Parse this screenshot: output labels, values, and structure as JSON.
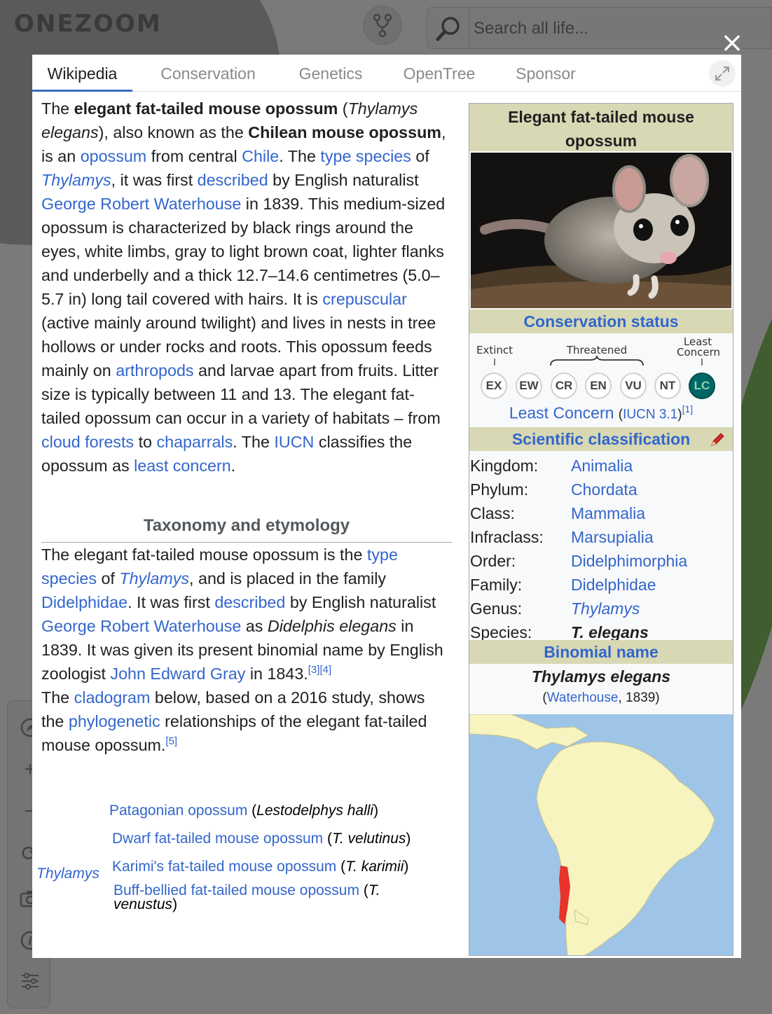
{
  "app": {
    "logo": "ONEZOOM",
    "search_placeholder": "Search all life...",
    "close_label": "×"
  },
  "tabs": [
    {
      "label": "Wikipedia",
      "active": true
    },
    {
      "label": "Conservation"
    },
    {
      "label": "Genetics"
    },
    {
      "label": "OpenTree"
    },
    {
      "label": "Sponsor"
    }
  ],
  "article": {
    "p1": [
      {
        "t": "The "
      },
      {
        "t": "elegant fat-tailed mouse opossum",
        "b": true
      },
      {
        "t": " ("
      },
      {
        "t": "Thylamys elegans",
        "i": true
      },
      {
        "t": "), also known as the "
      },
      {
        "t": "Chilean mouse opossum",
        "b": true
      },
      {
        "t": ", is an "
      },
      {
        "t": "opossum",
        "link": true
      },
      {
        "t": " from central "
      },
      {
        "t": "Chile",
        "link": true
      },
      {
        "t": ". The "
      },
      {
        "t": "type species",
        "link": true
      },
      {
        "t": " of "
      },
      {
        "t": "Thylamys",
        "link": true,
        "i": true
      },
      {
        "t": ", it was first "
      },
      {
        "t": "described",
        "link": true
      },
      {
        "t": " by English naturalist "
      },
      {
        "t": "George Robert Waterhouse",
        "link": true
      },
      {
        "t": " in 1839. This medium-sized opossum is characterized by black rings around the eyes, white limbs, gray to light brown coat, lighter flanks and underbelly and a thick 12.7–14.6 centimetres (5.0–5.7 in) long tail covered with hairs. It is "
      },
      {
        "t": "crepuscular",
        "link": true
      },
      {
        "t": " (active mainly around twilight) and lives in nests in tree hollows or under rocks and roots. This opossum feeds mainly on "
      },
      {
        "t": "arthropods",
        "link": true
      },
      {
        "t": " and larvae apart from fruits. Litter size is typically between 11 and 13. The elegant fat-tailed opossum can occur in a variety of habitats – from "
      },
      {
        "t": "cloud forests",
        "link": true
      },
      {
        "t": " to "
      },
      {
        "t": "chaparrals",
        "link": true
      },
      {
        "t": ". The "
      },
      {
        "t": "IUCN",
        "link": true
      },
      {
        "t": " classifies the opossum as "
      },
      {
        "t": "least concern",
        "link": true
      },
      {
        "t": "."
      }
    ],
    "section_title": "Taxonomy and etymology",
    "p2": [
      {
        "t": "The elegant fat-tailed mouse opossum is the "
      },
      {
        "t": "type species",
        "link": true
      },
      {
        "t": " of "
      },
      {
        "t": "Thylamys",
        "link": true,
        "i": true
      },
      {
        "t": ", and is placed in the family "
      },
      {
        "t": "Didelphidae",
        "link": true
      },
      {
        "t": ". It was first "
      },
      {
        "t": "described",
        "link": true
      },
      {
        "t": " by English naturalist "
      },
      {
        "t": "George Robert Waterhouse",
        "link": true
      },
      {
        "t": " as "
      },
      {
        "t": "Didelphis elegans",
        "i": true
      },
      {
        "t": " in 1839. It was given its present binomial name by English zoologist "
      },
      {
        "t": "John Edward Gray",
        "link": true
      },
      {
        "t": " in 1843."
      },
      {
        "t": "[3][4]",
        "sup": true
      }
    ],
    "p3": [
      {
        "t": "The "
      },
      {
        "t": "cladogram",
        "link": true
      },
      {
        "t": " below, based on a 2016 study, shows the "
      },
      {
        "t": "phylogenetic",
        "link": true
      },
      {
        "t": " relationships of the elegant fat-tailed mouse opossum."
      },
      {
        "t": "[5]",
        "sup": true
      }
    ]
  },
  "cladogram": {
    "root": "Thylamys",
    "rows": [
      {
        "name": "Patagonian opossum",
        "sci": "Lestodelphys halli"
      },
      {
        "name": "Dwarf fat-tailed mouse opossum",
        "sci": "T. velutinus"
      },
      {
        "name": "Karimi's fat-tailed mouse opossum",
        "sci": "T. karimii"
      },
      {
        "name": "Buff-bellied fat-tailed mouse opossum",
        "sci": "T. venustus"
      }
    ]
  },
  "infobox": {
    "title": "Elegant fat-tailed mouse opossum",
    "conservation_heading": "Conservation status",
    "scale_labels": {
      "extinct": "Extinct",
      "threatened": "Threatened",
      "least": "Least",
      "concern": "Concern"
    },
    "statuses": [
      "EX",
      "EW",
      "CR",
      "EN",
      "VU",
      "NT",
      "LC"
    ],
    "active_status": "LC",
    "status_name": "Least Concern",
    "status_source": "IUCN 3.1",
    "status_ref": "[1]",
    "classification_heading": "Scientific classification",
    "classification": [
      {
        "rank": "Kingdom:",
        "value": "Animalia"
      },
      {
        "rank": "Phylum:",
        "value": "Chordata"
      },
      {
        "rank": "Class:",
        "value": "Mammalia"
      },
      {
        "rank": "Infraclass:",
        "value": "Marsupialia"
      },
      {
        "rank": "Order:",
        "value": "Didelphimorphia"
      },
      {
        "rank": "Family:",
        "value": "Didelphidae"
      },
      {
        "rank": "Genus:",
        "value": "Thylamys"
      },
      {
        "rank": "Species:",
        "value": "T. elegans"
      }
    ],
    "binomial_heading": "Binomial name",
    "binomial": "Thylamys elegans",
    "authority_author": "Waterhouse",
    "authority_year": ", 1839",
    "colors": {
      "header_bg": "#d8d9b4",
      "link": "#3366cc",
      "range": "#e8332a",
      "land": "#f7f4c0",
      "sea": "#9ec5e8"
    }
  }
}
